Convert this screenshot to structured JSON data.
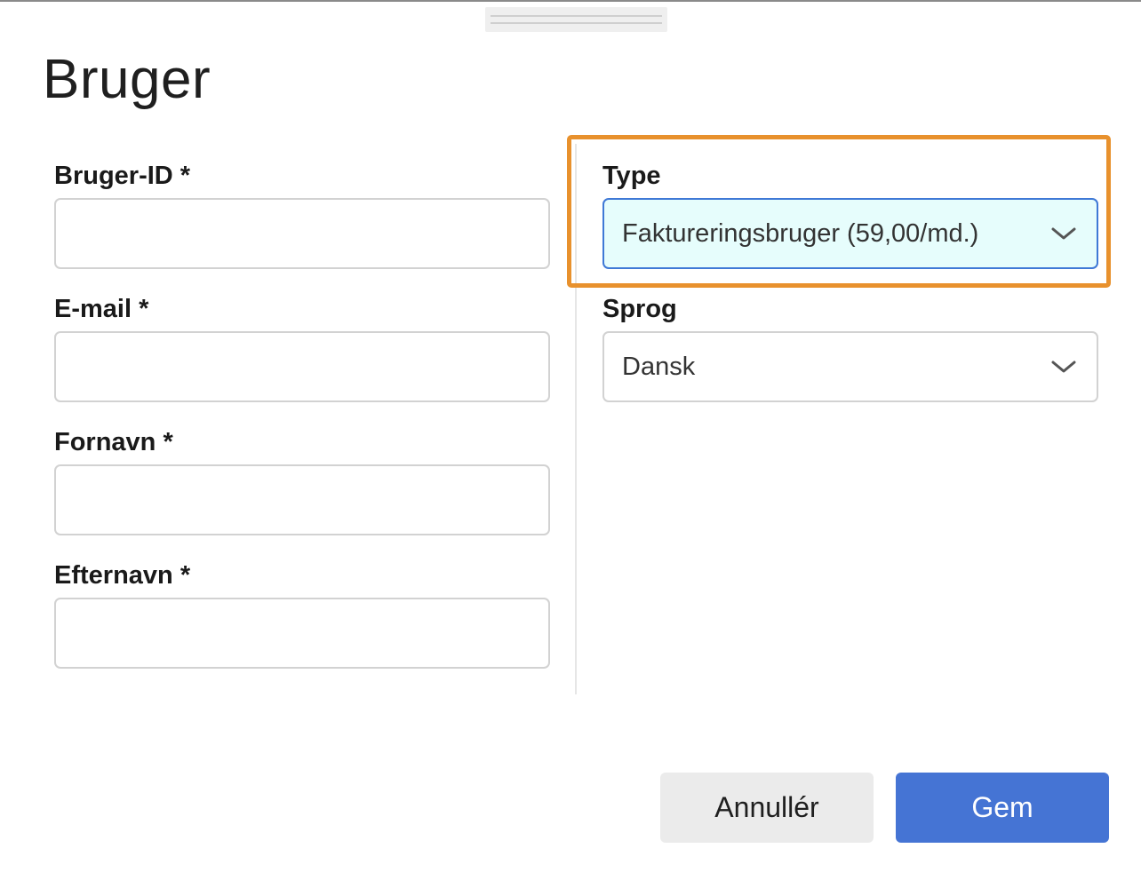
{
  "dialog": {
    "title": "Bruger"
  },
  "left_column": {
    "fields": [
      {
        "label": "Bruger-ID *",
        "value": "",
        "placeholder": ""
      },
      {
        "label": "E-mail *",
        "value": "",
        "placeholder": ""
      },
      {
        "label": "Fornavn *",
        "value": "",
        "placeholder": ""
      },
      {
        "label": "Efternavn *",
        "value": "",
        "placeholder": ""
      }
    ]
  },
  "right_column": {
    "type": {
      "label": "Type",
      "selected": "Faktureringsbruger (59,00/md.)",
      "icon": "chevron-down-icon"
    },
    "language": {
      "label": "Sprog",
      "selected": "Dansk",
      "icon": "chevron-down-icon"
    }
  },
  "footer": {
    "cancel_label": "Annullér",
    "save_label": "Gem"
  },
  "colors": {
    "highlight_border": "#e8912d",
    "active_select_bg": "#e6fdfc",
    "active_select_border": "#3f79d6",
    "primary_button": "#4574d4",
    "secondary_button": "#ebebeb"
  }
}
